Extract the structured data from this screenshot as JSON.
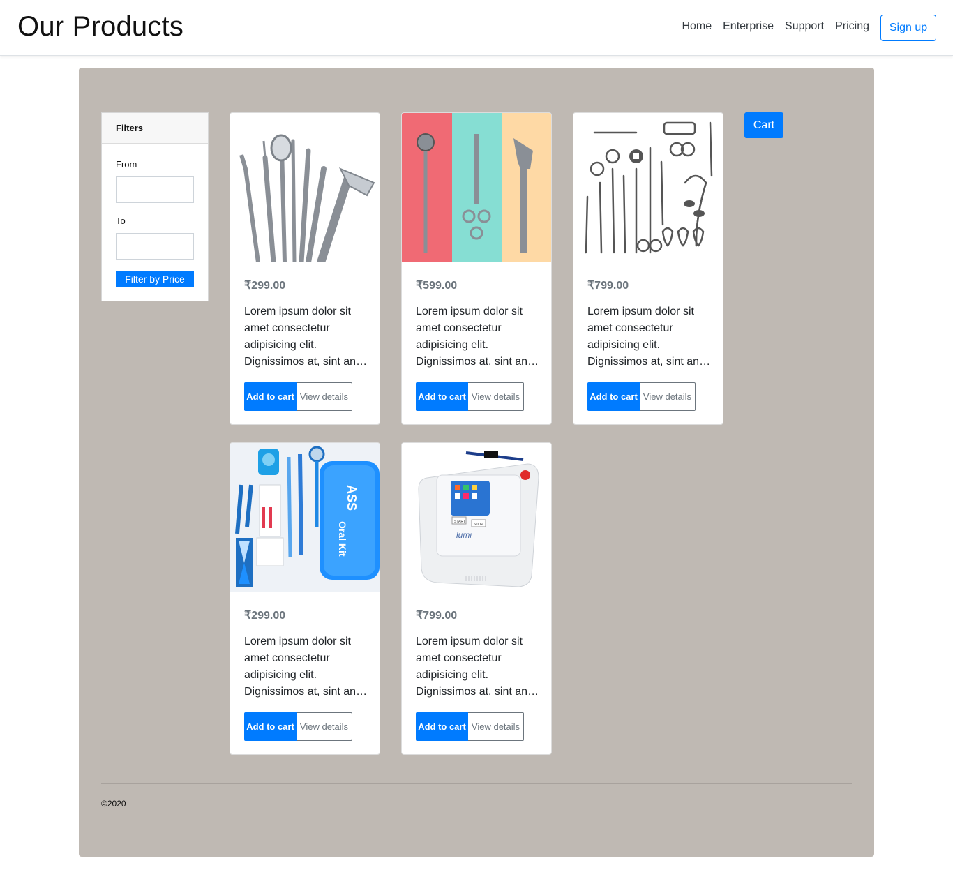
{
  "header": {
    "brand": "Our Products",
    "nav": [
      "Home",
      "Enterprise",
      "Support",
      "Pricing"
    ],
    "signup": "Sign up"
  },
  "filters": {
    "title": "Filters",
    "from_label": "From",
    "to_label": "To",
    "from_value": "",
    "to_value": "",
    "button": "Filter by Price"
  },
  "cart_label": "Cart",
  "products": [
    {
      "price": "₹299.00",
      "desc": "Lorem ipsum dolor sit amet consectetur adipisicing elit. Dignissimos at, sint an…",
      "add": "Add to cart",
      "view": "View details"
    },
    {
      "price": "₹599.00",
      "desc": "Lorem ipsum dolor sit amet consectetur adipisicing elit. Dignissimos at, sint an…",
      "add": "Add to cart",
      "view": "View details"
    },
    {
      "price": "₹799.00",
      "desc": "Lorem ipsum dolor sit amet consectetur adipisicing elit. Dignissimos at, sint an…",
      "add": "Add to cart",
      "view": "View details"
    },
    {
      "price": "₹299.00",
      "desc": "Lorem ipsum dolor sit amet consectetur adipisicing elit. Dignissimos at, sint an…",
      "add": "Add to cart",
      "view": "View details"
    },
    {
      "price": "₹799.00",
      "desc": "Lorem ipsum dolor sit amet consectetur adipisicing elit. Dignissimos at, sint an…",
      "add": "Add to cart",
      "view": "View details"
    }
  ],
  "image_text": {
    "kit_brand": "ASS",
    "kit_name": "Oral Kit",
    "device_start": "START",
    "device_stop": "STOP",
    "device_brand": "lumi"
  },
  "footer": {
    "copyright": "©2020"
  },
  "colors": {
    "accent": "#007bff",
    "panel": "#bfb9b3",
    "muted": "#6c757d"
  }
}
